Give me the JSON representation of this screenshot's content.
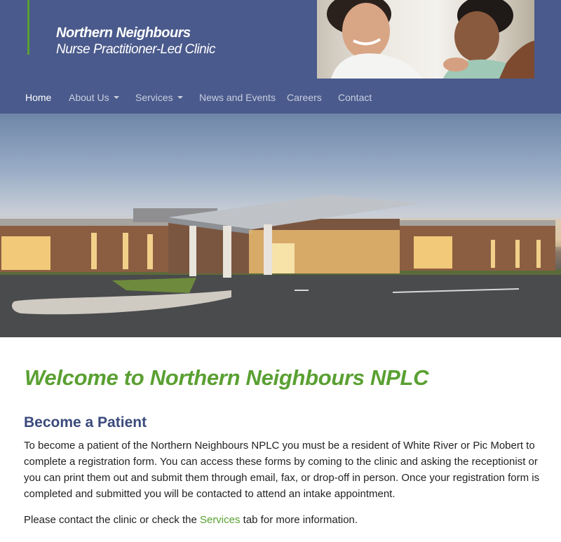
{
  "brand": {
    "title": "Northern Neighbours",
    "subtitle": "Nurse Practitioner-Led Clinic",
    "accent_color": "#5aa032",
    "header_color": "#4a5a8c"
  },
  "nav": {
    "items": [
      {
        "label": "Home",
        "active": true
      },
      {
        "label": "About Us",
        "dropdown": true
      },
      {
        "label": "Services",
        "dropdown": true
      },
      {
        "label": "News and Events"
      },
      {
        "label": "Careers"
      },
      {
        "label": "Contact"
      }
    ]
  },
  "main": {
    "welcome": "Welcome to Northern Neighbours NPLC",
    "section_title": "Become a Patient",
    "paragraph": "To become a patient of the Northern Neighbours NPLC you must be a resident of White River or Pic Mobert to complete a registration form. You can access these forms by coming to the clinic and asking the receptionist or you can print them out and submit them through email, fax, or drop-off in person. Once your registration form is completed and submitted you will be contacted to attend an intake appointment.",
    "contact_prefix": "Please contact the clinic or check the ",
    "contact_link": "Services",
    "contact_suffix": " tab for more information."
  }
}
